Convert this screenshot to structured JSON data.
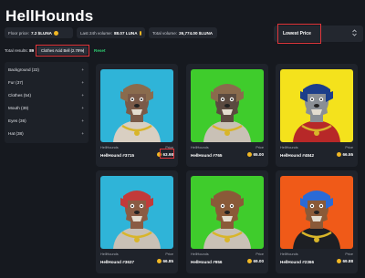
{
  "title": "HellHounds",
  "stats": [
    {
      "label": "Floor price:",
      "value": "7.2 $LUNA"
    },
    {
      "label": "Last 24h volume:",
      "value": "88.07 LUNA"
    },
    {
      "label": "Total volume:",
      "value": "26,774.00 $LUNA"
    }
  ],
  "sort": {
    "label": "Lowest Price",
    "chevron_icon": "chevron-up-down-icon"
  },
  "filters_bar": {
    "total_label": "Total results:",
    "total_value": "89",
    "chip_label": "Clothes Acid Bell (2.78%)",
    "chip_close": "×",
    "reset": "Reset"
  },
  "sidebar": {
    "items": [
      {
        "label": "Background (22)"
      },
      {
        "label": "Fur (37)"
      },
      {
        "label": "Clothes (54)"
      },
      {
        "label": "Mouth (39)"
      },
      {
        "label": "Eyes (36)"
      },
      {
        "label": "Hat (38)"
      }
    ],
    "plus": "+"
  },
  "cards": [
    {
      "collection": "HellHounds",
      "price_label": "Price",
      "name": "HellHound #3715",
      "price": "63.98",
      "bg": "#2fb4d8",
      "fur": "#7a5a48",
      "shirt": "#d9cfc2",
      "hat": "#8a6b4d"
    },
    {
      "collection": "HellHounds",
      "price_label": "Price",
      "name": "HellHound #765",
      "price": "65.00",
      "bg": "#3fcc2c",
      "fur": "#5b4a40",
      "shirt": "#c9c1b6",
      "hat": "#8a6b4d"
    },
    {
      "collection": "HellHounds",
      "price_label": "Price",
      "name": "HellHound #4842",
      "price": "66.55",
      "bg": "#f4e21c",
      "fur": "#8a8f95",
      "shirt": "#b72828",
      "hat": "#1c3e8a"
    },
    {
      "collection": "HellHounds",
      "price_label": "Price",
      "name": "HellHound #3637",
      "price": "66.85",
      "bg": "#2fb4d8",
      "fur": "#8a5c44",
      "shirt": "#c9c1b6",
      "hat": "#c23a3a"
    },
    {
      "collection": "HellHounds",
      "price_label": "Price",
      "name": "HellHound #956",
      "price": "69.00",
      "bg": "#3fcc2c",
      "fur": "#8a5a38",
      "shirt": "#c9c1b6",
      "hat": "#8a5a38"
    },
    {
      "collection": "HellHounds",
      "price_label": "Price",
      "name": "HellHound #2366",
      "price": "69.88",
      "bg": "#f05a18",
      "fur": "#8a5a38",
      "shirt": "#1d1f24",
      "hat": "#2a6ad6"
    }
  ],
  "colors": {
    "highlight": "#e0363b",
    "luna": "#f2b824",
    "reset": "#2ecc71"
  }
}
